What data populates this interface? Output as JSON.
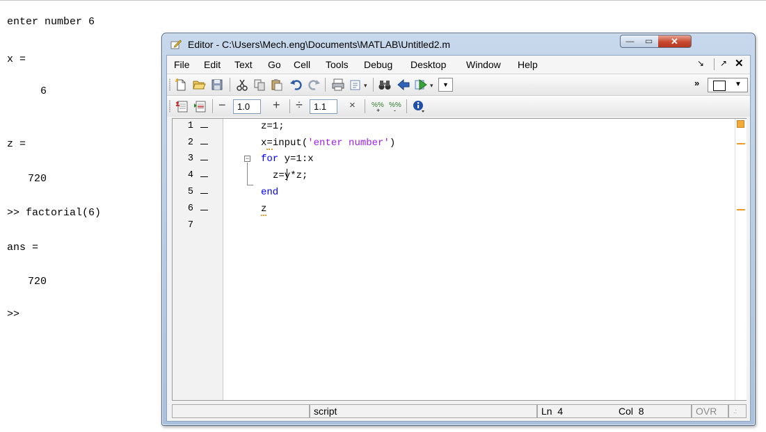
{
  "command_window": {
    "lines": [
      "enter number 6",
      "x =",
      "6",
      "z =",
      "720",
      ">> factorial(6)",
      "ans =",
      "720",
      ">>"
    ]
  },
  "editor": {
    "title": "Editor - C:\\Users\\Mech.eng\\Documents\\MATLAB\\Untitled2.m",
    "caption_buttons": {
      "minimize": "—",
      "maximize": "▭",
      "close": "✕"
    },
    "menu": [
      "File",
      "Edit",
      "Text",
      "Go",
      "Cell",
      "Tools",
      "Debug",
      "Desktop",
      "Window",
      "Help"
    ],
    "toolbar2": {
      "decrement": "−",
      "increment_value": "1.0",
      "plus": "+",
      "divide": "÷",
      "divide_value": "1.1",
      "multiply": "×"
    },
    "code": {
      "line_numbers": [
        "1",
        "2",
        "3",
        "4",
        "5",
        "6",
        "7"
      ],
      "line1": "z=1;",
      "line2_a": "x",
      "line2_b": "=",
      "line2_c": "input(",
      "line2_str": "'enter number'",
      "line2_d": ")",
      "line3_kw": "for",
      "line3_rest": " y=1:x",
      "line4_a": "z=y",
      "line4_b": "*z;",
      "line5_kw": "end",
      "line6": "z"
    },
    "status": {
      "mode": "script",
      "ln_label": "Ln",
      "ln_value": "4",
      "col_label": "Col",
      "col_value": "8",
      "ovr": "OVR"
    }
  },
  "colors": {
    "keyword": "#0000ff",
    "string": "#a020f0",
    "warning": "#f09a26",
    "title_bar": "#b8cde6"
  }
}
